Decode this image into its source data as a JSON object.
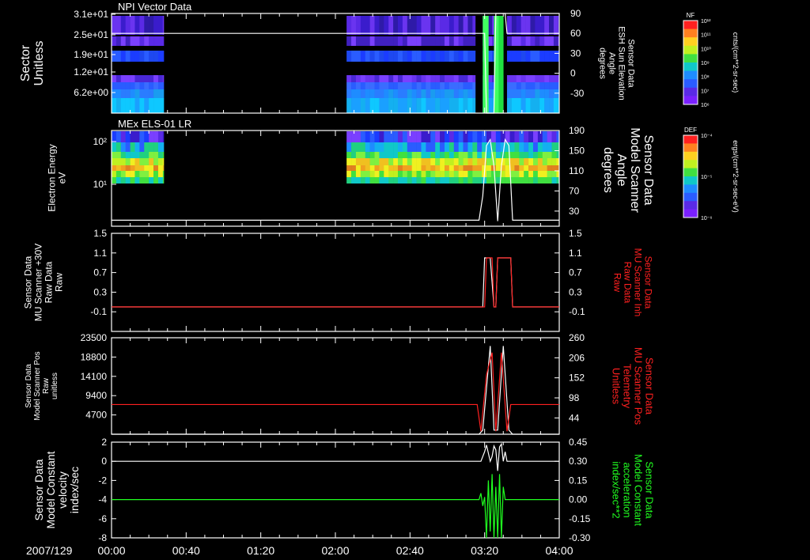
{
  "colors": {
    "background": "#000000",
    "axis": "#ffffff",
    "red_trace": "#ff2020",
    "green_trace": "#20ff20",
    "white_trace": "#ffffff"
  },
  "date_label": "2007/129",
  "x_axis": {
    "range_minutes": [
      0,
      240
    ],
    "ticks": [
      {
        "minute": 0,
        "label": "00:00"
      },
      {
        "minute": 40,
        "label": "00:40"
      },
      {
        "minute": 80,
        "label": "01:20"
      },
      {
        "minute": 120,
        "label": "02:00"
      },
      {
        "minute": 160,
        "label": "02:40"
      },
      {
        "minute": 200,
        "label": "03:20"
      },
      {
        "minute": 240,
        "label": "04:00"
      }
    ]
  },
  "colorbars": [
    {
      "id": "npi",
      "title": "NF",
      "units": "cnts/(cm**2-sr-sec)",
      "tick_labels": [
        "10¹²",
        "10¹¹",
        "10¹⁰",
        "10⁹",
        "10⁸",
        "10⁷",
        "10⁶"
      ]
    },
    {
      "id": "els",
      "title": "DEF",
      "units": "ergs/(cm**2-sr-sec-eV)",
      "tick_labels": [
        "10⁻⁴",
        "10⁻⁵",
        "10⁻⁶"
      ]
    }
  ],
  "chart_data": [
    {
      "type": "heatmap",
      "title": "NPI Vector Data",
      "ylabel_left": [
        "Sector",
        "Unitless"
      ],
      "ylabel_right": [
        "Sensor Data",
        "ESH Sun Elevation",
        "Angle",
        "degrees"
      ],
      "left_ticks": [
        "3.1e+01",
        "2.5e+01",
        "1.9e+01",
        "1.2e+01",
        "6.2e+00"
      ],
      "right_ticks": [
        90,
        60,
        30,
        0,
        -30
      ],
      "right_range": [
        -60,
        90
      ],
      "data_intervals_minutes": [
        [
          0,
          28
        ],
        [
          126,
          195
        ],
        [
          199,
          210
        ],
        [
          212,
          240
        ]
      ],
      "white_line": [
        {
          "t": 0,
          "deg": 60
        },
        {
          "t": 200,
          "deg": 60
        },
        {
          "t": 201,
          "deg": -60
        },
        {
          "t": 205,
          "deg": -60
        },
        {
          "t": 206,
          "deg": 90
        },
        {
          "t": 211,
          "deg": 90
        },
        {
          "t": 212,
          "deg": 60
        },
        {
          "t": 240,
          "deg": 60
        }
      ]
    },
    {
      "type": "heatmap",
      "title": "MEx ELS-01 LR",
      "ylabel_left": [
        "Electron Energy",
        "eV"
      ],
      "ylabel_right": [
        "Sensor Data",
        "Model Scanner",
        "Angle",
        "degrees"
      ],
      "left_ticks": [
        "10²",
        "10¹"
      ],
      "right_ticks": [
        190,
        150,
        110,
        70,
        30
      ],
      "right_range": [
        0,
        190
      ],
      "data_intervals_minutes": [
        [
          0,
          28
        ],
        [
          126,
          240
        ]
      ],
      "white_line": [
        {
          "t": 0,
          "deg": 12
        },
        {
          "t": 197,
          "deg": 12
        },
        {
          "t": 199,
          "deg": 60
        },
        {
          "t": 201,
          "deg": 160
        },
        {
          "t": 203,
          "deg": 172
        },
        {
          "t": 205,
          "deg": 120
        },
        {
          "t": 207,
          "deg": 10
        },
        {
          "t": 209,
          "deg": 120
        },
        {
          "t": 211,
          "deg": 172
        },
        {
          "t": 213,
          "deg": 160
        },
        {
          "t": 215,
          "deg": 12
        },
        {
          "t": 240,
          "deg": 12
        }
      ]
    },
    {
      "type": "line",
      "ylabel_left": [
        "Sensor Data",
        "MU Scanner +30V",
        "Raw Data",
        "Raw"
      ],
      "ylabel_right": [
        "Sensor Data",
        "MU Scanner Inh",
        "Raw Data",
        "Raw"
      ],
      "left_ticks": [
        1.5,
        1.1,
        0.7,
        0.3,
        -0.1
      ],
      "right_ticks": [
        1.5,
        1.1,
        0.7,
        0.3,
        -0.1
      ],
      "ylim": [
        -0.5,
        1.5
      ],
      "series": [
        {
          "color": "white",
          "points": [
            [
              0,
              0
            ],
            [
              199,
              0
            ],
            [
              200,
              1
            ],
            [
              203,
              1
            ],
            [
              205,
              0
            ],
            [
              206,
              0
            ],
            [
              207,
              1
            ],
            [
              214,
              1
            ],
            [
              215,
              0
            ],
            [
              240,
              0
            ]
          ]
        },
        {
          "color": "red",
          "points": [
            [
              0,
              0
            ],
            [
              200,
              0
            ],
            [
              201,
              1
            ],
            [
              204,
              1
            ],
            [
              205,
              0
            ],
            [
              206,
              0
            ],
            [
              207,
              1
            ],
            [
              214,
              1
            ],
            [
              215,
              0
            ],
            [
              240,
              0
            ]
          ]
        }
      ]
    },
    {
      "type": "line",
      "ylabel_left": [
        "Sensor Data",
        "Model Scanner Pos",
        "Raw",
        "unitless"
      ],
      "ylabel_right": [
        "Sensor Data",
        "MU Scanner Pos",
        "Telemetry",
        "Unitless"
      ],
      "left_ticks": [
        23500,
        18800,
        14100,
        9400,
        4700
      ],
      "right_ticks": [
        260,
        206,
        152,
        98,
        44
      ],
      "ylim_left": [
        0,
        23500
      ],
      "ylim_right": [
        0,
        260
      ],
      "series": [
        {
          "color": "white",
          "axis": "left",
          "points": [
            [
              0,
              0
            ],
            [
              197,
              0
            ],
            [
              199,
              1000
            ],
            [
              203,
              21500
            ],
            [
              205,
              1000
            ],
            [
              207,
              1000
            ],
            [
              210,
              21500
            ],
            [
              213,
              1000
            ],
            [
              215,
              0
            ],
            [
              240,
              0
            ]
          ]
        },
        {
          "color": "red",
          "axis": "right",
          "points": [
            [
              0,
              80
            ],
            [
              196,
              80
            ],
            [
              198,
              8
            ],
            [
              201,
              160
            ],
            [
              204,
              220
            ],
            [
              206,
              8
            ],
            [
              209,
              220
            ],
            [
              212,
              8
            ],
            [
              214,
              80
            ],
            [
              240,
              80
            ]
          ]
        }
      ]
    },
    {
      "type": "line",
      "ylabel_left": [
        "Sensor Data",
        "Model Constant",
        "velocity",
        "index/sec"
      ],
      "ylabel_right": [
        "Sensor Data",
        "Model Constant",
        "acceleration",
        "index/sec**2"
      ],
      "left_ticks": [
        2,
        0,
        -2,
        -4,
        -6,
        -8
      ],
      "right_ticks": [
        "0.45",
        "0.30",
        "0.15",
        "0.00",
        "-0.15",
        "-0.30"
      ],
      "ylim_left": [
        -8,
        2
      ],
      "ylim_right": [
        -0.3,
        0.45
      ],
      "series": [
        {
          "color": "white",
          "axis": "left",
          "points": [
            [
              0,
              0
            ],
            [
              198,
              0
            ],
            [
              200,
              1
            ],
            [
              201,
              1.7
            ],
            [
              203,
              0
            ],
            [
              204,
              0.5
            ],
            [
              205,
              1.6
            ],
            [
              206,
              1.2
            ],
            [
              207,
              -1
            ],
            [
              208,
              1.5
            ],
            [
              209,
              1.8
            ],
            [
              210,
              0
            ],
            [
              211,
              1
            ],
            [
              212,
              0
            ],
            [
              240,
              0
            ]
          ]
        },
        {
          "color": "green",
          "axis": "right",
          "points": [
            [
              0,
              0
            ],
            [
              197,
              0
            ],
            [
              198,
              0.05
            ],
            [
              199,
              -0.05
            ],
            [
              200,
              0.02
            ],
            [
              201,
              -0.3
            ],
            [
              202,
              0.15
            ],
            [
              203,
              -0.25
            ],
            [
              204,
              0.2
            ],
            [
              205,
              -0.3
            ],
            [
              206,
              0.1
            ],
            [
              207,
              -0.3
            ],
            [
              208,
              0.2
            ],
            [
              209,
              -0.3
            ],
            [
              210,
              0.1
            ],
            [
              211,
              0
            ],
            [
              240,
              0
            ]
          ]
        }
      ]
    }
  ]
}
